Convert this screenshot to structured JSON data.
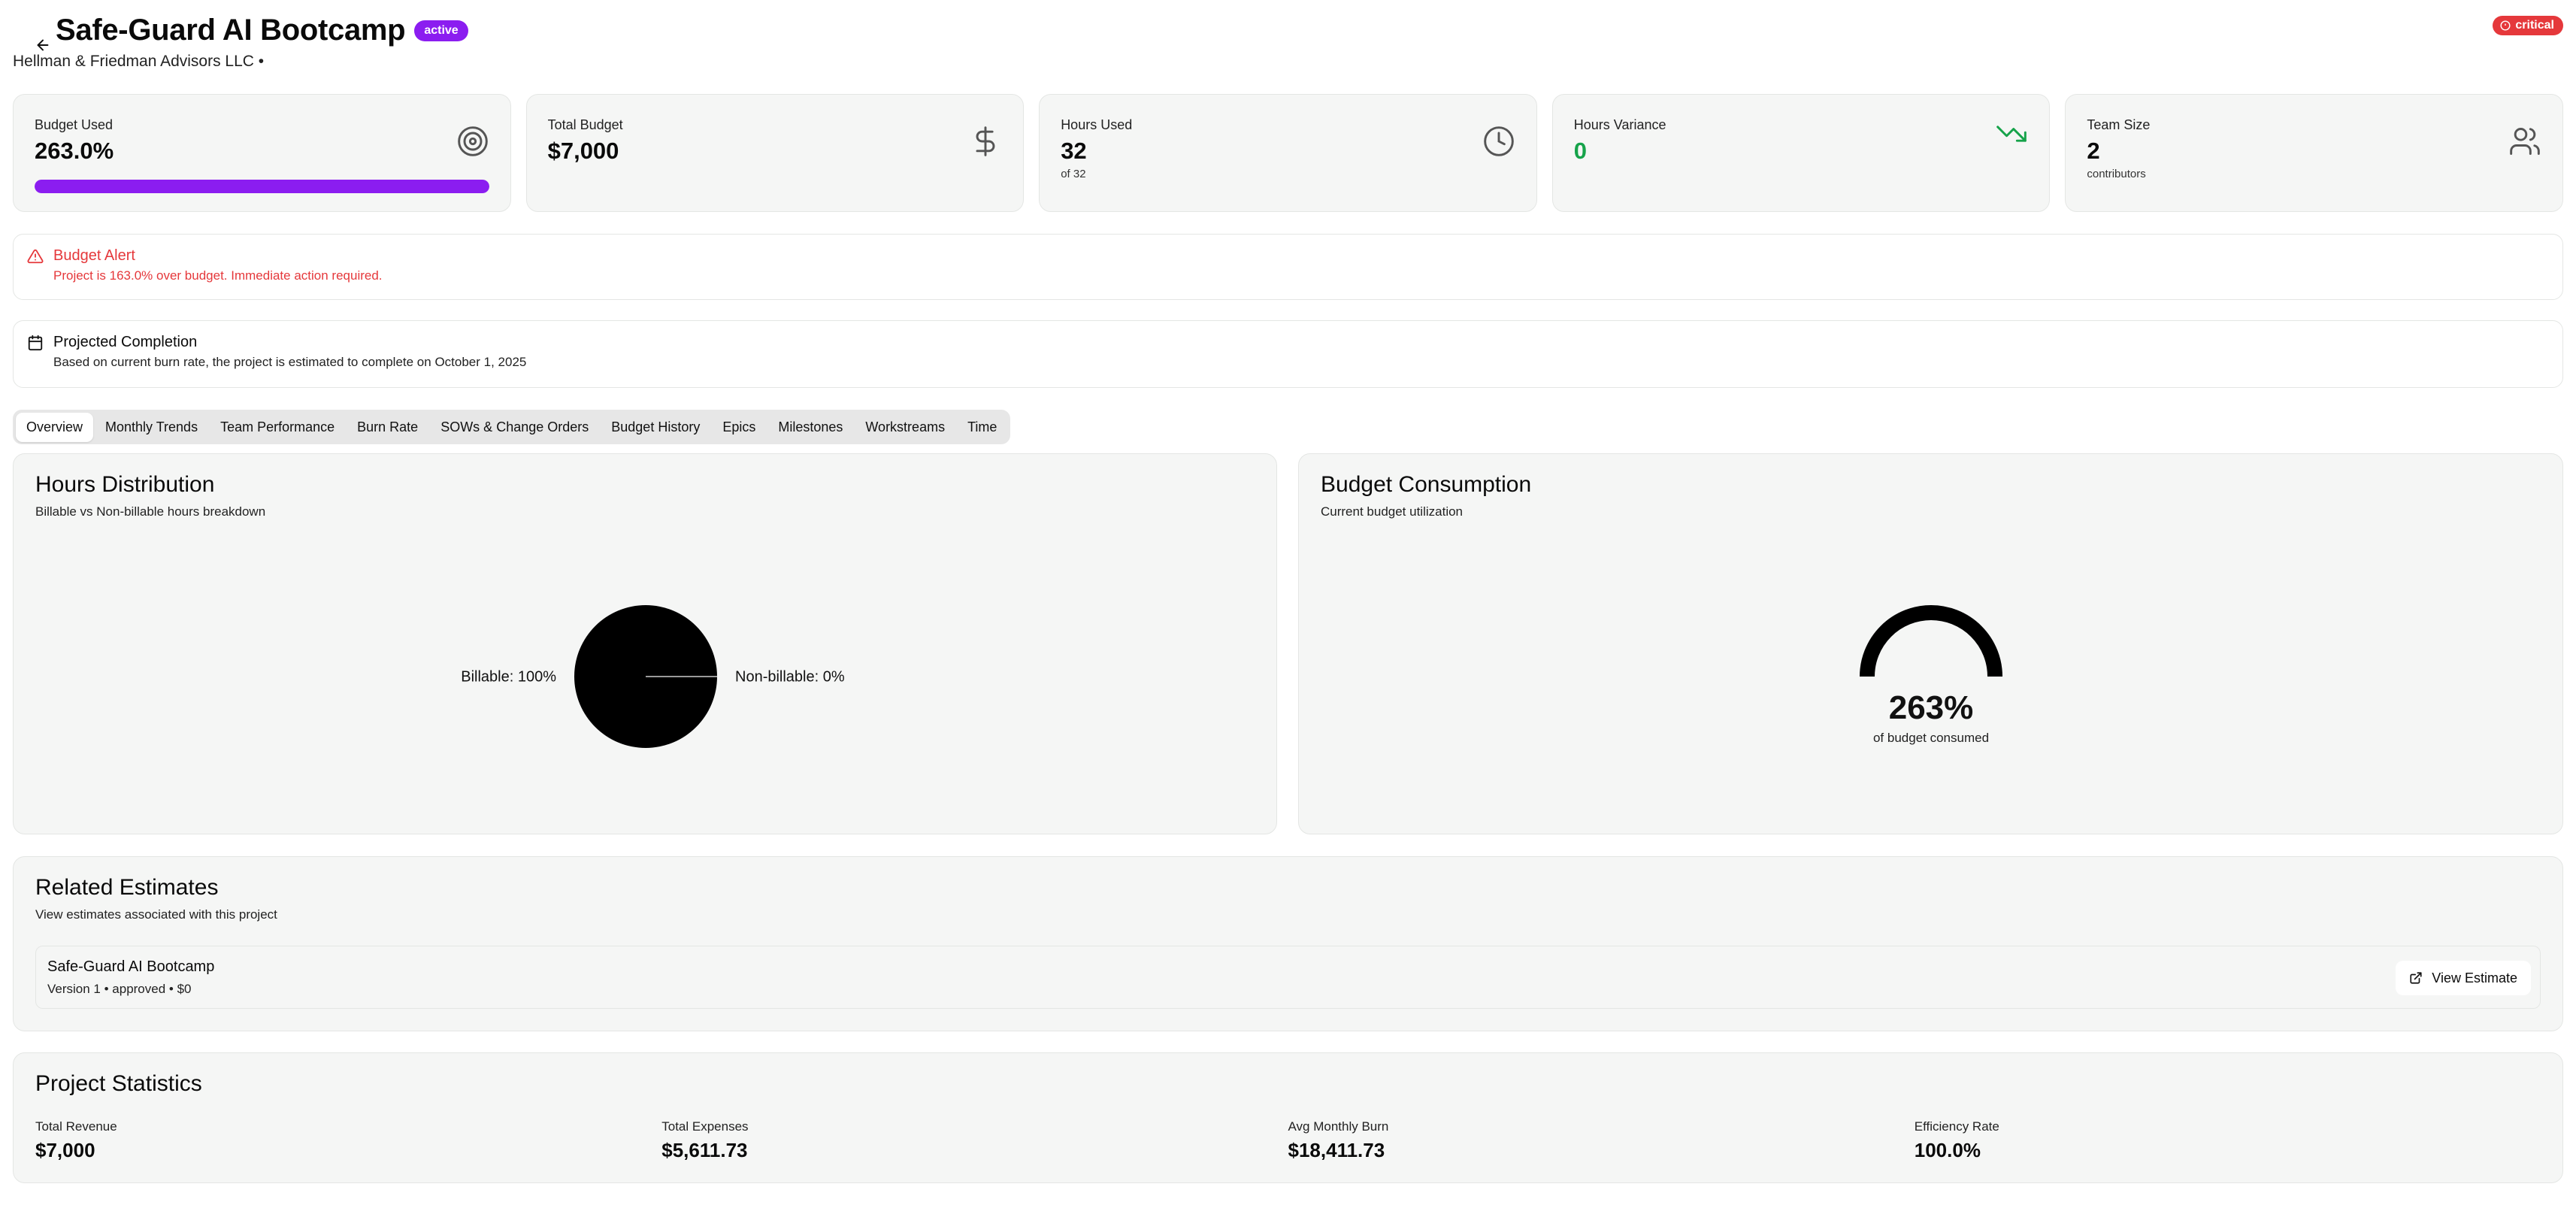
{
  "header": {
    "title": "Safe-Guard AI Bootcamp",
    "status_badge": "active",
    "client": "Hellman & Friedman Advisors LLC •",
    "severity_badge": "critical"
  },
  "stats": {
    "budget_used": {
      "label": "Budget Used",
      "value": "263.0%",
      "progress_fraction": 1.0
    },
    "total_budget": {
      "label": "Total Budget",
      "value": "$7,000"
    },
    "hours_used": {
      "label": "Hours Used",
      "value": "32",
      "sub": "of 32"
    },
    "hours_variance": {
      "label": "Hours Variance",
      "value": "0"
    },
    "team_size": {
      "label": "Team Size",
      "value": "2",
      "sub": "contributors"
    }
  },
  "alerts": {
    "budget": {
      "title": "Budget Alert",
      "text": "Project is 163.0% over budget. Immediate action required."
    },
    "projection": {
      "title": "Projected Completion",
      "text": "Based on current burn rate, the project is estimated to complete on October 1, 2025"
    }
  },
  "tabs": [
    {
      "label": "Overview",
      "active": true
    },
    {
      "label": "Monthly Trends",
      "active": false
    },
    {
      "label": "Team Performance",
      "active": false
    },
    {
      "label": "Burn Rate",
      "active": false
    },
    {
      "label": "SOWs & Change Orders",
      "active": false
    },
    {
      "label": "Budget History",
      "active": false
    },
    {
      "label": "Epics",
      "active": false
    },
    {
      "label": "Milestones",
      "active": false
    },
    {
      "label": "Workstreams",
      "active": false
    },
    {
      "label": "Time",
      "active": false
    }
  ],
  "hours_distribution": {
    "title": "Hours Distribution",
    "description": "Billable vs Non-billable hours breakdown"
  },
  "budget_consumption": {
    "title": "Budget Consumption",
    "description": "Current budget utilization"
  },
  "chart_data": [
    {
      "type": "pie",
      "categories": [
        "Billable",
        "Non-billable"
      ],
      "values": [
        100,
        0
      ],
      "labels": [
        "Billable: 100%",
        "Non-billable: 0%"
      ]
    },
    {
      "type": "gauge",
      "value": 263,
      "value_label": "263%",
      "caption": "of budget consumed"
    }
  ],
  "related_estimates": {
    "title": "Related Estimates",
    "description": "View estimates associated with this project",
    "items": [
      {
        "name": "Safe-Guard AI Bootcamp",
        "meta": "Version 1 • approved • $0",
        "button": "View Estimate"
      }
    ]
  },
  "project_statistics": {
    "title": "Project Statistics",
    "items": [
      {
        "label": "Total Revenue",
        "value": "$7,000"
      },
      {
        "label": "Total Expenses",
        "value": "$5,611.73"
      },
      {
        "label": "Avg Monthly Burn",
        "value": "$18,411.73"
      },
      {
        "label": "Efficiency Rate",
        "value": "100.0%"
      }
    ]
  },
  "colors": {
    "accent": "#8b1df0",
    "critical": "#e5383b",
    "positive": "#16a34a"
  }
}
